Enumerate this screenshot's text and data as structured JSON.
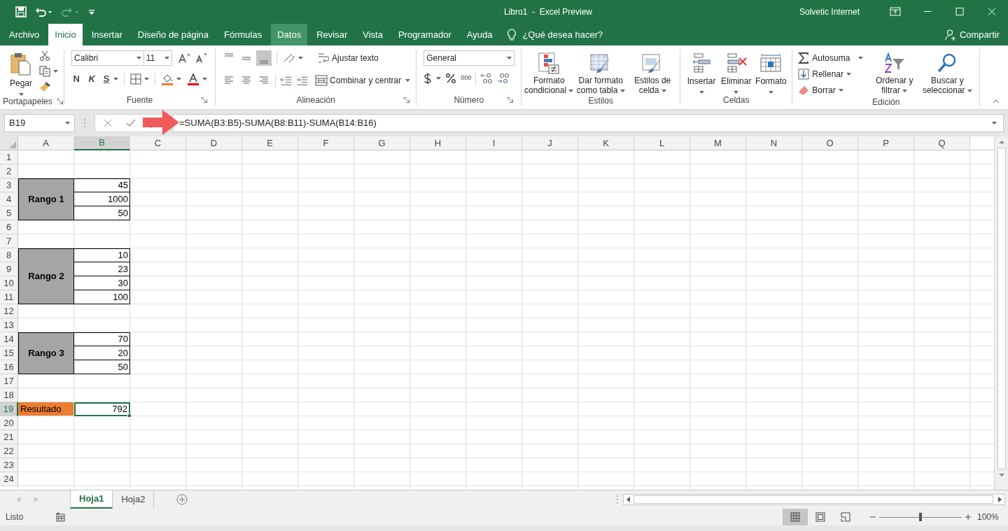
{
  "title_bar": {
    "title": "Libro1  -  Excel Preview",
    "user": "Solvetic Internet"
  },
  "ribbon_tabs": [
    {
      "label": "Archivo",
      "selected": false,
      "hovered": false
    },
    {
      "label": "Inicio",
      "selected": true,
      "hovered": false
    },
    {
      "label": "Insertar",
      "selected": false,
      "hovered": false
    },
    {
      "label": "Diseño de página",
      "selected": false,
      "hovered": false
    },
    {
      "label": "Fórmulas",
      "selected": false,
      "hovered": false
    },
    {
      "label": "Datos",
      "selected": false,
      "hovered": true
    },
    {
      "label": "Revisar",
      "selected": false,
      "hovered": false
    },
    {
      "label": "Vista",
      "selected": false,
      "hovered": false
    },
    {
      "label": "Programador",
      "selected": false,
      "hovered": false
    },
    {
      "label": "Ayuda",
      "selected": false,
      "hovered": false
    }
  ],
  "tell_me": {
    "placeholder": "¿Qué desea hacer?"
  },
  "share": "Compartir",
  "ribbon": {
    "clipboard": {
      "label": "Portapapeles",
      "paste": "Pegar"
    },
    "font": {
      "label": "Fuente",
      "font_name": "Calibri",
      "font_size": "11",
      "bold": "N",
      "italic": "K",
      "underline": "S"
    },
    "alignment": {
      "label": "Alineación",
      "wrap": "Ajustar texto",
      "merge": "Combinar y centrar"
    },
    "number": {
      "label": "Número",
      "format": "General",
      "thousands": "000"
    },
    "styles": {
      "label": "Estilos",
      "buttons": [
        "Formato condicional",
        "Dar formato como tabla",
        "Estilos de celda"
      ]
    },
    "cells": {
      "label": "Celdas",
      "buttons": [
        "Insertar",
        "Eliminar",
        "Formato"
      ]
    },
    "editing": {
      "label": "Edición",
      "small_buttons": [
        "Autosuma",
        "Rellenar",
        "Borrar"
      ],
      "buttons": [
        "Ordenar y filtrar",
        "Buscar y seleccionar"
      ]
    }
  },
  "formula_bar": {
    "name_box": "B19",
    "formula": "=SUMA(B3:B5)-SUMA(B8:B11)-SUMA(B14:B16)"
  },
  "sheet": {
    "columns": [
      "A",
      "B",
      "C",
      "D",
      "E",
      "F",
      "G",
      "H",
      "I",
      "J",
      "K",
      "L",
      "M",
      "N",
      "O",
      "P",
      "Q"
    ],
    "row_numbers": [
      "1",
      "2",
      "3",
      "4",
      "5",
      "6",
      "7",
      "8",
      "9",
      "10",
      "11",
      "12",
      "13",
      "14",
      "15",
      "16",
      "17",
      "18",
      "19",
      "20",
      "21",
      "22",
      "23",
      "24"
    ],
    "blocks": [
      {
        "label": "Rango 1",
        "values": [
          "45",
          "1000",
          "50"
        ]
      },
      {
        "label": "Rango 2",
        "values": [
          "10",
          "23",
          "30",
          "100"
        ]
      },
      {
        "label": "Rango 3",
        "values": [
          "70",
          "20",
          "50"
        ]
      }
    ],
    "result": {
      "label": "Resultado",
      "value": "792",
      "selected": true
    }
  },
  "sheet_tabs": [
    {
      "label": "Hoja1",
      "selected": true
    },
    {
      "label": "Hoja2",
      "selected": false
    }
  ],
  "status_bar": {
    "status": "Listo",
    "zoom": "100%",
    "zoom_slider": {
      "level": 0.5
    },
    "views": [
      {
        "kind": "normal",
        "selected": true
      },
      {
        "kind": "layout",
        "selected": false
      },
      {
        "kind": "pagebreak",
        "selected": false
      }
    ]
  }
}
